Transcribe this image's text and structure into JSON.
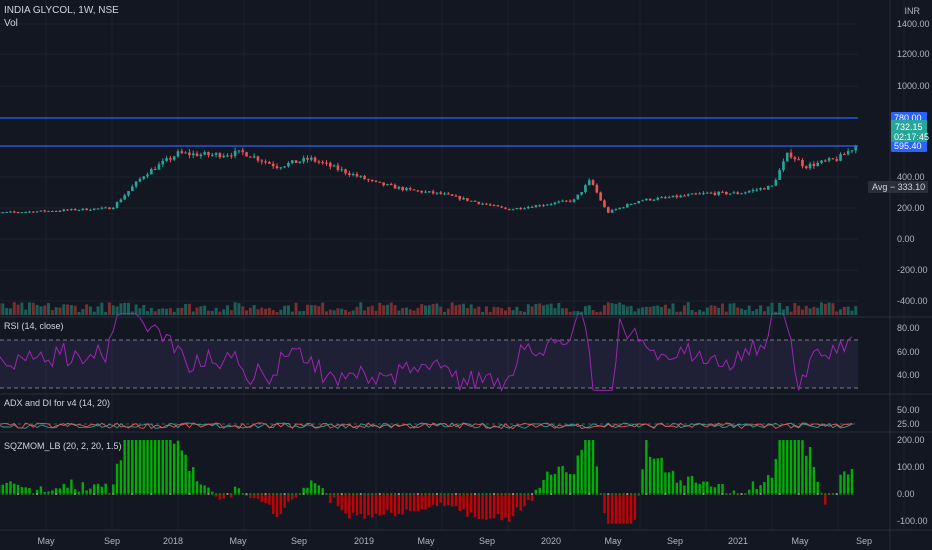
{
  "header": {
    "symbol": "INDIA GLYCOL, 1W, NSE",
    "volume_label": "Vol",
    "currency": "INR"
  },
  "colors": {
    "background": "#131722",
    "up": "#26a69a",
    "down": "#ef5350",
    "hline": "#2962ff",
    "rsi_line": "#9c27b0",
    "rsi_band": "#7e57c2",
    "sqz_green": "#00c800",
    "sqz_red": "#e00000"
  },
  "price_panel": {
    "y_ticks": [
      "1400.00",
      "1200.00",
      "1000.00",
      "400.00",
      "200.00",
      "0.00",
      "-200.00",
      "-400.00"
    ],
    "hlines": [
      780.0,
      595.4
    ],
    "hline_labels": [
      "780.00",
      "595.40"
    ],
    "last_price": "732.15",
    "countdown": "02:17:45",
    "avg_label": "Avg",
    "avg_value": "333.10"
  },
  "rsi_panel": {
    "label": "RSI (14, close)",
    "y_ticks": [
      "80.00",
      "60.00",
      "40.00"
    ]
  },
  "adx_panel": {
    "label": "ADX and DI for v4 (14, 20)",
    "y_ticks": [
      "50.00",
      "25.00"
    ]
  },
  "sqz_panel": {
    "label": "SQZMOM_LB (20, 2, 20, 1.5)",
    "y_ticks": [
      "200.00",
      "100.00",
      "0.00",
      "-100.00"
    ]
  },
  "x_axis": {
    "labels": [
      "May",
      "Sep",
      "2018",
      "May",
      "Sep",
      "2019",
      "May",
      "Sep",
      "2020",
      "May",
      "Sep",
      "2021",
      "May",
      "Sep"
    ]
  },
  "chart_data": {
    "type": "candlestick",
    "title": "INDIA GLYCOL, 1W, NSE",
    "price_anchors": [
      [
        "2017-01",
        165
      ],
      [
        "2017-05",
        180
      ],
      [
        "2017-09",
        200
      ],
      [
        "2017-11",
        420
      ],
      [
        "2018-01",
        555
      ],
      [
        "2018-03",
        545
      ],
      [
        "2018-05",
        560
      ],
      [
        "2018-07",
        470
      ],
      [
        "2018-09",
        520
      ],
      [
        "2018-11",
        440
      ],
      [
        "2019-01",
        360
      ],
      [
        "2019-03",
        315
      ],
      [
        "2019-05",
        290
      ],
      [
        "2019-07",
        240
      ],
      [
        "2019-09",
        190
      ],
      [
        "2019-11",
        220
      ],
      [
        "2020-01",
        250
      ],
      [
        "2020-02",
        380
      ],
      [
        "2020-03",
        170
      ],
      [
        "2020-05",
        250
      ],
      [
        "2020-07",
        270
      ],
      [
        "2020-09",
        295
      ],
      [
        "2020-11",
        295
      ],
      [
        "2021-01",
        340
      ],
      [
        "2021-02",
        560
      ],
      [
        "2021-03",
        470
      ],
      [
        "2021-05",
        520
      ],
      [
        "2021-06",
        600
      ],
      [
        "2021-07",
        750
      ],
      [
        "2021-08",
        732
      ]
    ],
    "hlines": [
      780.0,
      595.4
    ],
    "ylim": [
      -400,
      1400
    ],
    "rsi_levels": [
      70,
      30
    ],
    "sqz_range": [
      -100,
      200
    ]
  }
}
